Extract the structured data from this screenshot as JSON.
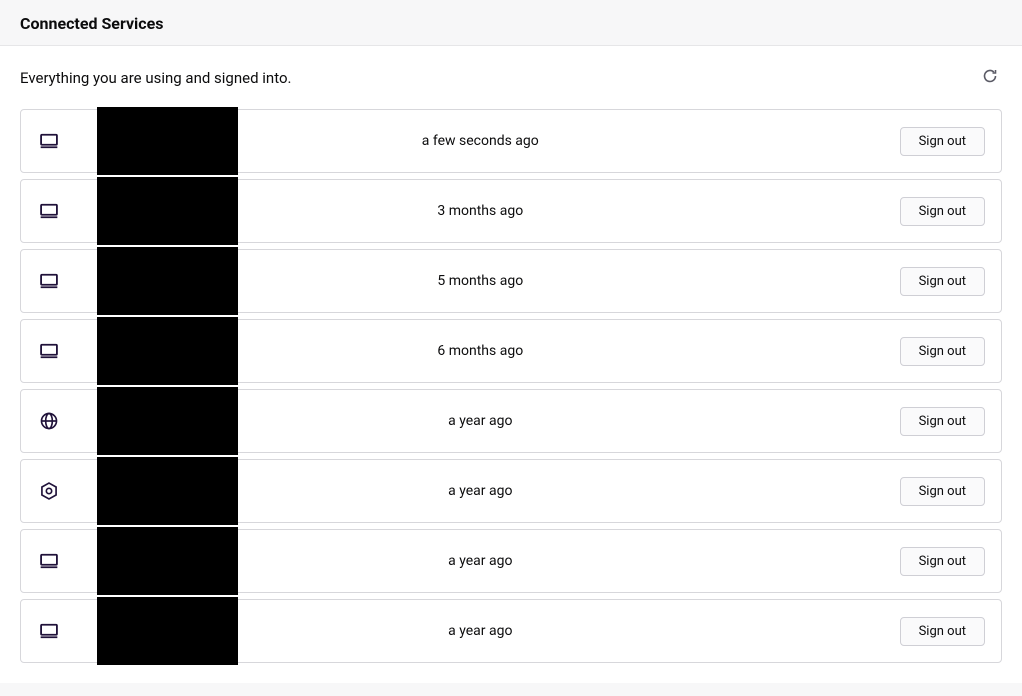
{
  "header": {
    "title": "Connected Services"
  },
  "sub": {
    "description": "Everything you are using and signed into."
  },
  "signout_label": "Sign out",
  "rows": [
    {
      "icon": "desktop",
      "time": "a few seconds ago"
    },
    {
      "icon": "desktop",
      "time": "3 months ago"
    },
    {
      "icon": "desktop",
      "time": "5 months ago"
    },
    {
      "icon": "desktop",
      "time": "6 months ago"
    },
    {
      "icon": "globe",
      "time": "a year ago"
    },
    {
      "icon": "addon",
      "time": "a year ago"
    },
    {
      "icon": "desktop",
      "time": "a year ago"
    },
    {
      "icon": "desktop",
      "time": "a year ago"
    }
  ]
}
